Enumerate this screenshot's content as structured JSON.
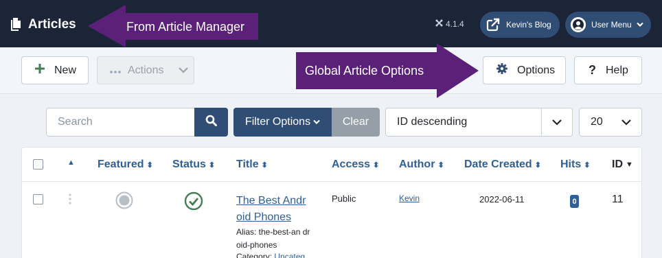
{
  "header": {
    "title": "Articles",
    "version": "4.1.4",
    "site_link": "Kevin's Blog",
    "user_menu": "User Menu"
  },
  "toolbar": {
    "new_label": "New",
    "actions_label": "Actions",
    "options_label": "Options",
    "help_label": "Help"
  },
  "filters": {
    "search_placeholder": "Search",
    "filter_options_label": "Filter Options",
    "clear_label": "Clear",
    "ordering": "ID descending",
    "limit": "20"
  },
  "table": {
    "columns": [
      "Featured",
      "Status",
      "Title",
      "Access",
      "Author",
      "Date Created",
      "Hits",
      "ID"
    ],
    "rows": [
      {
        "title": "The Best Andr oid Phones",
        "alias": "Alias: the-best-an droid-phones",
        "category_label": "Category:",
        "category_value": "Uncateg",
        "access": "Public",
        "author": "Kevin",
        "date_created": "2022-06-11",
        "hits": "0",
        "id": "11"
      }
    ]
  },
  "annotations": {
    "article_manager": "From Article Manager",
    "global_options": "Global Article Options"
  },
  "colors": {
    "header_bg": "#1c2538",
    "primary": "#2f4d75",
    "link": "#2f5f96",
    "annotation": "#5b2179",
    "status_published": "#457d54"
  }
}
